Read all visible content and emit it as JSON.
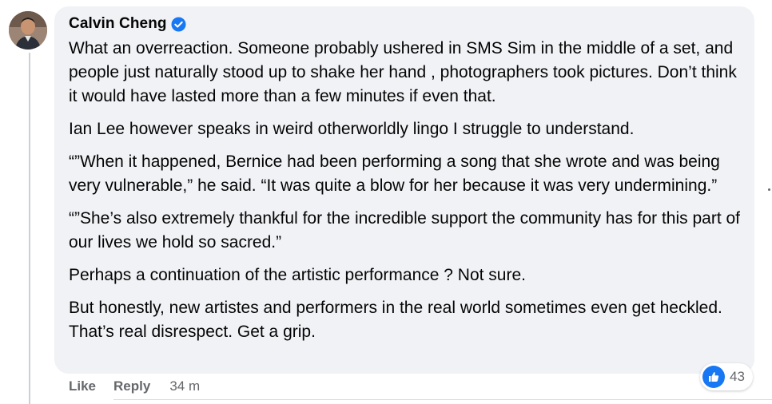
{
  "comment": {
    "author": "Calvin Cheng",
    "verified": true,
    "paragraphs": [
      "What an overreaction. Someone probably ushered in SMS Sim in the middle of a set, and people just naturally stood up to shake her hand , photographers took pictures. Don’t think it would have lasted more than a few minutes if even that.",
      "Ian Lee however speaks in weird otherworldly lingo I struggle to understand.",
      "“”When it happened, Bernice had been performing a song that she wrote and was being very vulnerable,” he said. “It was quite a blow for her because it was very undermining.”",
      "“”She’s also extremely thankful for the incredible support the community has for this part of our lives we hold so sacred.”",
      "Perhaps a continuation of the artistic performance ? Not sure.",
      "But honestly, new artistes and performers in the real world sometimes even get heckled. That’s real disrespect. Get a grip."
    ]
  },
  "actions": {
    "like_label": "Like",
    "reply_label": "Reply",
    "timestamp": "34 m"
  },
  "reactions": {
    "icon": "thumbs-up-icon",
    "count": "43"
  },
  "colors": {
    "bubble": "#f0f2f5",
    "like_blue": "#1877f2",
    "secondary_text": "#65676b"
  }
}
